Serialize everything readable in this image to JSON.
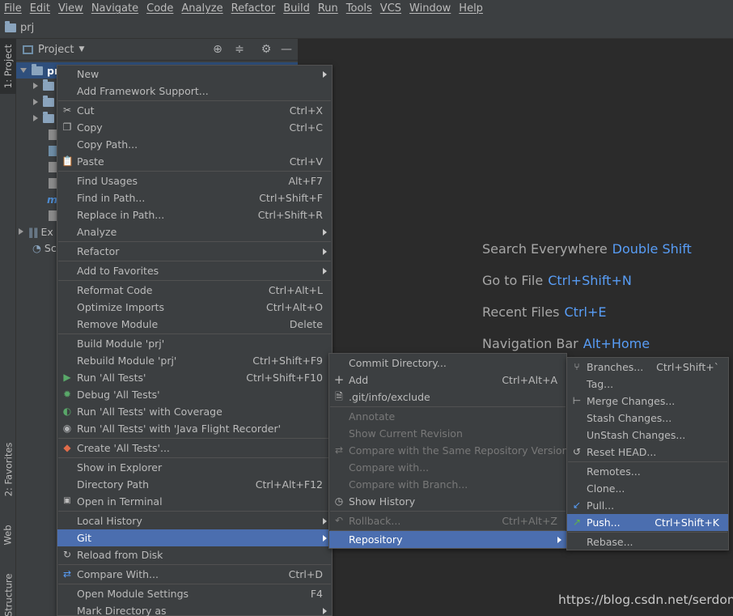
{
  "menubar": [
    "File",
    "Edit",
    "View",
    "Navigate",
    "Code",
    "Analyze",
    "Refactor",
    "Build",
    "Run",
    "Tools",
    "VCS",
    "Window",
    "Help"
  ],
  "navbar": {
    "project": "prj"
  },
  "sidetabs": {
    "project": "1: Project",
    "favorites": "2: Favorites",
    "web": "Web",
    "structure": "Z: Structure"
  },
  "project_panel": {
    "title": "Project",
    "root_label": "pr",
    "ext_label": "Ex",
    "scratch_label": "Sc"
  },
  "editor_hints": [
    {
      "label": "Search Everywhere",
      "key": "Double Shift"
    },
    {
      "label": "Go to File",
      "key": "Ctrl+Shift+N"
    },
    {
      "label": "Recent Files",
      "key": "Ctrl+E"
    },
    {
      "label": "Navigation Bar",
      "key": "Alt+Home"
    }
  ],
  "watermark": "https://blog.csdn.net/serdonty",
  "context_menu": [
    {
      "label": "New",
      "shortcut": "",
      "submenu": true
    },
    {
      "label": "Add Framework Support...",
      "shortcut": ""
    },
    {
      "label": "Cut",
      "shortcut": "Ctrl+X",
      "icon": "scissors-icon"
    },
    {
      "label": "Copy",
      "shortcut": "Ctrl+C",
      "icon": "copy-icon"
    },
    {
      "label": "Copy Path...",
      "shortcut": ""
    },
    {
      "label": "Paste",
      "shortcut": "Ctrl+V",
      "icon": "paste-icon"
    },
    {
      "label": "Find Usages",
      "shortcut": "Alt+F7"
    },
    {
      "label": "Find in Path...",
      "shortcut": "Ctrl+Shift+F"
    },
    {
      "label": "Replace in Path...",
      "shortcut": "Ctrl+Shift+R"
    },
    {
      "label": "Analyze",
      "shortcut": "",
      "submenu": true
    },
    {
      "label": "Refactor",
      "shortcut": "",
      "submenu": true
    },
    {
      "label": "Add to Favorites",
      "shortcut": "",
      "submenu": true
    },
    {
      "label": "Reformat Code",
      "shortcut": "Ctrl+Alt+L"
    },
    {
      "label": "Optimize Imports",
      "shortcut": "Ctrl+Alt+O"
    },
    {
      "label": "Remove Module",
      "shortcut": "Delete"
    },
    {
      "label": "Build Module 'prj'",
      "shortcut": ""
    },
    {
      "label": "Rebuild Module 'prj'",
      "shortcut": "Ctrl+Shift+F9"
    },
    {
      "label": "Run 'All Tests'",
      "shortcut": "Ctrl+Shift+F10",
      "icon": "run-icon"
    },
    {
      "label": "Debug 'All Tests'",
      "shortcut": "",
      "icon": "debug-icon"
    },
    {
      "label": "Run 'All Tests' with Coverage",
      "shortcut": "",
      "icon": "coverage-icon"
    },
    {
      "label": "Run 'All Tests' with 'Java Flight Recorder'",
      "shortcut": "",
      "icon": "flight-recorder-icon"
    },
    {
      "label": "Create 'All Tests'...",
      "shortcut": "",
      "icon": "create-test-icon"
    },
    {
      "label": "Show in Explorer",
      "shortcut": ""
    },
    {
      "label": "Directory Path",
      "shortcut": "Ctrl+Alt+F12"
    },
    {
      "label": "Open in Terminal",
      "shortcut": "",
      "icon": "terminal-icon"
    },
    {
      "label": "Local History",
      "shortcut": "",
      "submenu": true
    },
    {
      "label": "Git",
      "shortcut": "",
      "submenu": true
    },
    {
      "label": "Reload from Disk",
      "shortcut": "",
      "icon": "reload-icon"
    },
    {
      "label": "Compare With...",
      "shortcut": "Ctrl+D",
      "icon": "compare-icon"
    },
    {
      "label": "Open Module Settings",
      "shortcut": "F4"
    },
    {
      "label": "Mark Directory as",
      "shortcut": "",
      "submenu": true
    }
  ],
  "git_menu": [
    {
      "label": "Commit Directory...",
      "shortcut": ""
    },
    {
      "label": "Add",
      "shortcut": "Ctrl+Alt+A",
      "icon": "plus-icon"
    },
    {
      "label": ".git/info/exclude",
      "shortcut": "",
      "icon": "exclude-file-icon"
    },
    {
      "label": "Annotate",
      "shortcut": ""
    },
    {
      "label": "Show Current Revision",
      "shortcut": ""
    },
    {
      "label": "Compare with the Same Repository Version",
      "shortcut": "",
      "icon": "compare-icon"
    },
    {
      "label": "Compare with...",
      "shortcut": ""
    },
    {
      "label": "Compare with Branch...",
      "shortcut": ""
    },
    {
      "label": "Show History",
      "shortcut": "",
      "icon": "clock-icon"
    },
    {
      "label": "Rollback...",
      "shortcut": "Ctrl+Alt+Z",
      "icon": "rollback-icon"
    },
    {
      "label": "Repository",
      "shortcut": "",
      "submenu": true
    }
  ],
  "repo_menu": [
    {
      "label": "Branches...",
      "shortcut": "Ctrl+Shift+`",
      "icon": "branch-icon"
    },
    {
      "label": "Tag...",
      "shortcut": ""
    },
    {
      "label": "Merge Changes...",
      "shortcut": "",
      "icon": "merge-icon"
    },
    {
      "label": "Stash Changes...",
      "shortcut": ""
    },
    {
      "label": "UnStash Changes...",
      "shortcut": ""
    },
    {
      "label": "Reset HEAD...",
      "shortcut": "",
      "icon": "reset-icon"
    },
    {
      "label": "Remotes...",
      "shortcut": ""
    },
    {
      "label": "Clone...",
      "shortcut": ""
    },
    {
      "label": "Pull...",
      "shortcut": "",
      "icon": "pull-arrow-icon"
    },
    {
      "label": "Push...",
      "shortcut": "Ctrl+Shift+K",
      "icon": "push-arrow-icon"
    },
    {
      "label": "Rebase...",
      "shortcut": ""
    }
  ],
  "colors": {
    "selection": "#4b6eaf",
    "menu_bg": "#3c3f41",
    "editor_bg": "#2b2b2b",
    "hint_key": "#589df6"
  }
}
